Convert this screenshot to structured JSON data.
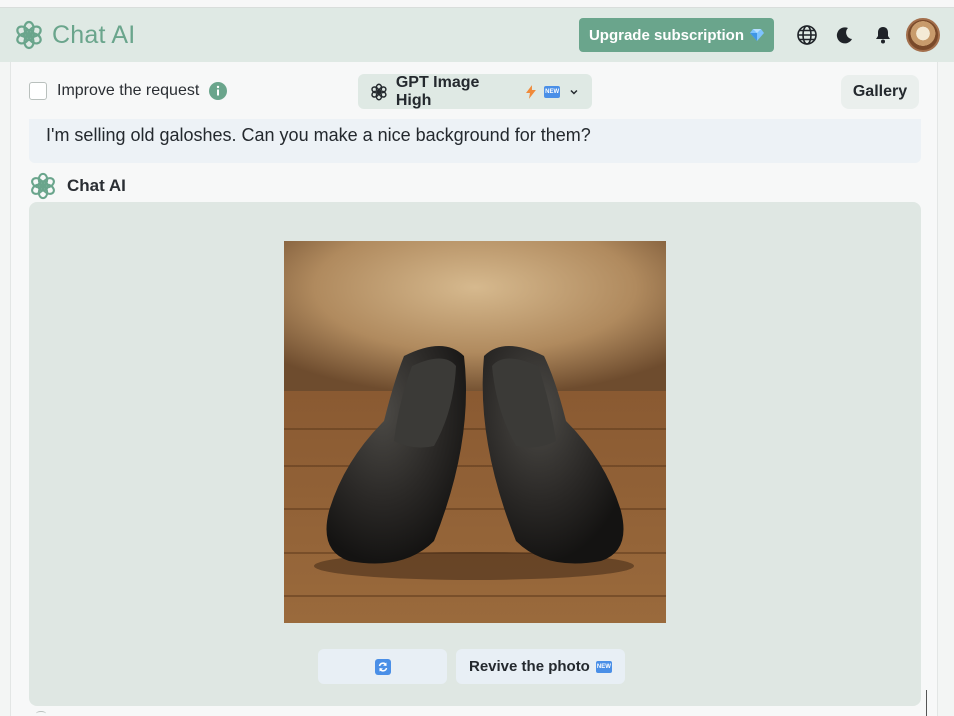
{
  "app": {
    "title": "Chat AI"
  },
  "header": {
    "upgrade_label": "Upgrade subscription",
    "icons": [
      "globe-icon",
      "moon-icon",
      "bell-icon",
      "user-avatar"
    ]
  },
  "toolbar": {
    "improve_label": "Improve the request",
    "improve_checked": false,
    "model_label": "GPT Image High",
    "model_badge": "NEW",
    "gallery_label": "Gallery"
  },
  "conversation": {
    "user_message": "I'm selling old galoshes. Can you make a nice background for them?",
    "assistant_name": "Chat AI",
    "actions": {
      "revive_label": "Revive the photo",
      "revive_badge": "NEW"
    }
  },
  "colors": {
    "brand": "#6aa58c",
    "header_bg": "#dfe9e4",
    "new_badge": "#4a8fe7"
  }
}
